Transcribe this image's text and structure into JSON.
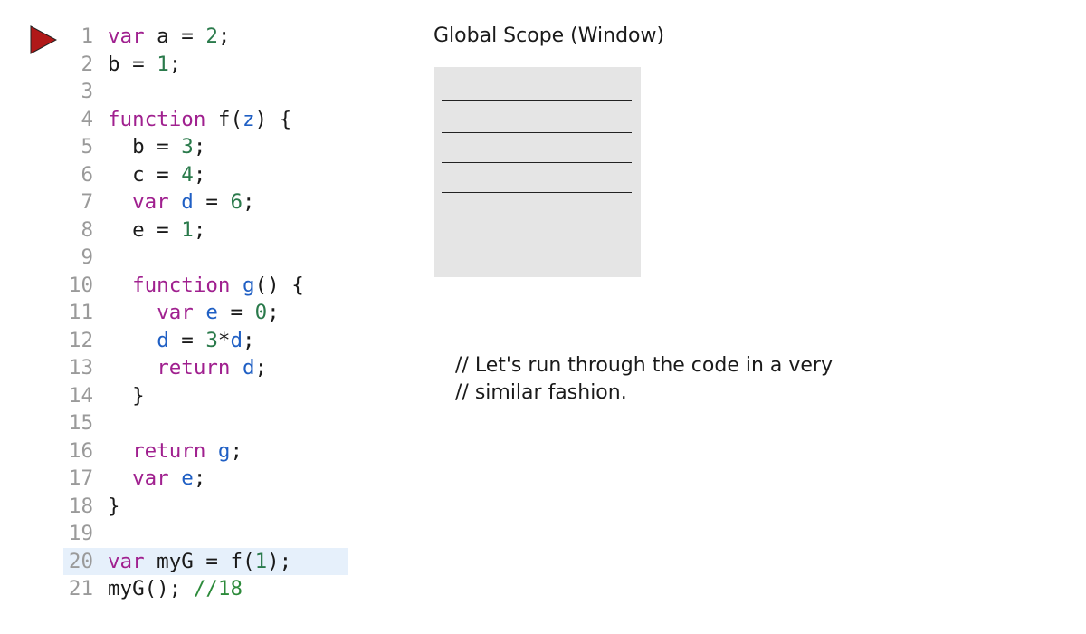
{
  "code": {
    "lines": [
      {
        "num": "1",
        "tokens": [
          {
            "t": "var",
            "c": "kw"
          },
          {
            "t": " a = ",
            "c": "plain"
          },
          {
            "t": "2",
            "c": "num"
          },
          {
            "t": ";",
            "c": "plain"
          }
        ]
      },
      {
        "num": "2",
        "tokens": [
          {
            "t": "b = ",
            "c": "plain"
          },
          {
            "t": "1",
            "c": "num"
          },
          {
            "t": ";",
            "c": "plain"
          }
        ]
      },
      {
        "num": "3",
        "tokens": []
      },
      {
        "num": "4",
        "tokens": [
          {
            "t": "function",
            "c": "kw"
          },
          {
            "t": " f(",
            "c": "plain"
          },
          {
            "t": "z",
            "c": "var"
          },
          {
            "t": ") {",
            "c": "plain"
          }
        ]
      },
      {
        "num": "5",
        "tokens": [
          {
            "t": "  b = ",
            "c": "plain"
          },
          {
            "t": "3",
            "c": "num"
          },
          {
            "t": ";",
            "c": "plain"
          }
        ]
      },
      {
        "num": "6",
        "tokens": [
          {
            "t": "  c = ",
            "c": "plain"
          },
          {
            "t": "4",
            "c": "num"
          },
          {
            "t": ";",
            "c": "plain"
          }
        ]
      },
      {
        "num": "7",
        "tokens": [
          {
            "t": "  ",
            "c": "plain"
          },
          {
            "t": "var",
            "c": "kw"
          },
          {
            "t": " ",
            "c": "plain"
          },
          {
            "t": "d",
            "c": "var"
          },
          {
            "t": " = ",
            "c": "plain"
          },
          {
            "t": "6",
            "c": "num"
          },
          {
            "t": ";",
            "c": "plain"
          }
        ]
      },
      {
        "num": "8",
        "tokens": [
          {
            "t": "  e = ",
            "c": "plain"
          },
          {
            "t": "1",
            "c": "num"
          },
          {
            "t": ";",
            "c": "plain"
          }
        ]
      },
      {
        "num": "9",
        "tokens": []
      },
      {
        "num": "10",
        "tokens": [
          {
            "t": "  ",
            "c": "plain"
          },
          {
            "t": "function",
            "c": "kw"
          },
          {
            "t": " ",
            "c": "plain"
          },
          {
            "t": "g",
            "c": "fn"
          },
          {
            "t": "() {",
            "c": "plain"
          }
        ]
      },
      {
        "num": "11",
        "tokens": [
          {
            "t": "    ",
            "c": "plain"
          },
          {
            "t": "var",
            "c": "kw"
          },
          {
            "t": " ",
            "c": "plain"
          },
          {
            "t": "e",
            "c": "var"
          },
          {
            "t": " = ",
            "c": "plain"
          },
          {
            "t": "0",
            "c": "num"
          },
          {
            "t": ";",
            "c": "plain"
          }
        ]
      },
      {
        "num": "12",
        "tokens": [
          {
            "t": "    ",
            "c": "plain"
          },
          {
            "t": "d",
            "c": "var"
          },
          {
            "t": " = ",
            "c": "plain"
          },
          {
            "t": "3",
            "c": "num"
          },
          {
            "t": "*",
            "c": "plain"
          },
          {
            "t": "d",
            "c": "var"
          },
          {
            "t": ";",
            "c": "plain"
          }
        ]
      },
      {
        "num": "13",
        "tokens": [
          {
            "t": "    ",
            "c": "plain"
          },
          {
            "t": "return",
            "c": "kw"
          },
          {
            "t": " ",
            "c": "plain"
          },
          {
            "t": "d",
            "c": "var"
          },
          {
            "t": ";",
            "c": "plain"
          }
        ]
      },
      {
        "num": "14",
        "tokens": [
          {
            "t": "  }",
            "c": "plain"
          }
        ]
      },
      {
        "num": "15",
        "tokens": []
      },
      {
        "num": "16",
        "tokens": [
          {
            "t": "  ",
            "c": "plain"
          },
          {
            "t": "return",
            "c": "kw"
          },
          {
            "t": " ",
            "c": "plain"
          },
          {
            "t": "g",
            "c": "fn"
          },
          {
            "t": ";",
            "c": "plain"
          }
        ]
      },
      {
        "num": "17",
        "tokens": [
          {
            "t": "  ",
            "c": "plain"
          },
          {
            "t": "var",
            "c": "kw"
          },
          {
            "t": " ",
            "c": "plain"
          },
          {
            "t": "e",
            "c": "var"
          },
          {
            "t": ";",
            "c": "plain"
          }
        ]
      },
      {
        "num": "18",
        "tokens": [
          {
            "t": "}",
            "c": "plain"
          }
        ]
      },
      {
        "num": "19",
        "tokens": []
      },
      {
        "num": "20",
        "tokens": [
          {
            "t": "var",
            "c": "kw"
          },
          {
            "t": " myG = f(",
            "c": "plain"
          },
          {
            "t": "1",
            "c": "num"
          },
          {
            "t": ");",
            "c": "plain"
          }
        ],
        "current": true
      },
      {
        "num": "21",
        "tokens": [
          {
            "t": "myG(); ",
            "c": "plain"
          },
          {
            "t": "//18",
            "c": "com"
          }
        ]
      }
    ]
  },
  "scope": {
    "title": "Global Scope (Window)",
    "slot_count": 5
  },
  "comment": {
    "text": "// Let's run through the code in a very\n// similar fashion."
  },
  "colors": {
    "arrow": "#b01818",
    "keyword": "#a0208f",
    "number": "#2a7a4b",
    "variable": "#1f5fc4",
    "current_line_bg": "#e6f0fb",
    "scope_bg": "#e5e5e5"
  },
  "icons": {
    "run_arrow": "play-triangle-icon"
  }
}
